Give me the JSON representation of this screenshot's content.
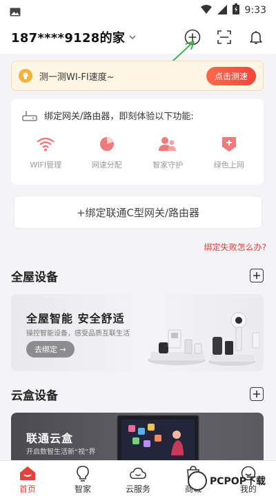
{
  "status_bar": {
    "time": "9:33"
  },
  "header": {
    "home_name": "187****9128的家"
  },
  "speed_banner": {
    "text": "测一测WI-FI速度~",
    "button": "点击测速"
  },
  "bind_card": {
    "title": "绑定网关/路由器，即刻体验以下功能:",
    "features": [
      {
        "label": "WIFI管理",
        "icon": "wifi-icon"
      },
      {
        "label": "网速分配",
        "icon": "pie-chart-icon"
      },
      {
        "label": "智家守护",
        "icon": "family-guard-icon"
      },
      {
        "label": "绿色上网",
        "icon": "green-web-icon"
      }
    ]
  },
  "bind_unicom_button": "+绑定联通C型网关/路由器",
  "bind_fail_link": "绑定失败怎么办?",
  "sections": {
    "whole_home": {
      "title": "全屋设备",
      "promo_title": "全屋智能  安全舒适",
      "promo_sub": "操控智能设备，感受品质互联生活",
      "promo_button": "去绑定 →"
    },
    "cloud_box": {
      "title": "云盒设备",
      "promo_title": "联通云盒",
      "promo_sub": "开启数智生活新“视”界"
    }
  },
  "tabbar": {
    "items": [
      {
        "label": "首页",
        "icon": "home-icon",
        "active": true
      },
      {
        "label": "智家",
        "icon": "bulb-icon",
        "active": false
      },
      {
        "label": "云服务",
        "icon": "cloud-icon",
        "active": false
      },
      {
        "label": "商城",
        "icon": "mall-icon",
        "active": false
      },
      {
        "label": "我的",
        "icon": "profile-icon",
        "active": false
      }
    ]
  },
  "watermark": {
    "text": "PCPOP下载"
  },
  "colors": {
    "accent": "#e8403a",
    "banner_bg": "#fff6e6",
    "page_bg": "#f4f4f6"
  }
}
